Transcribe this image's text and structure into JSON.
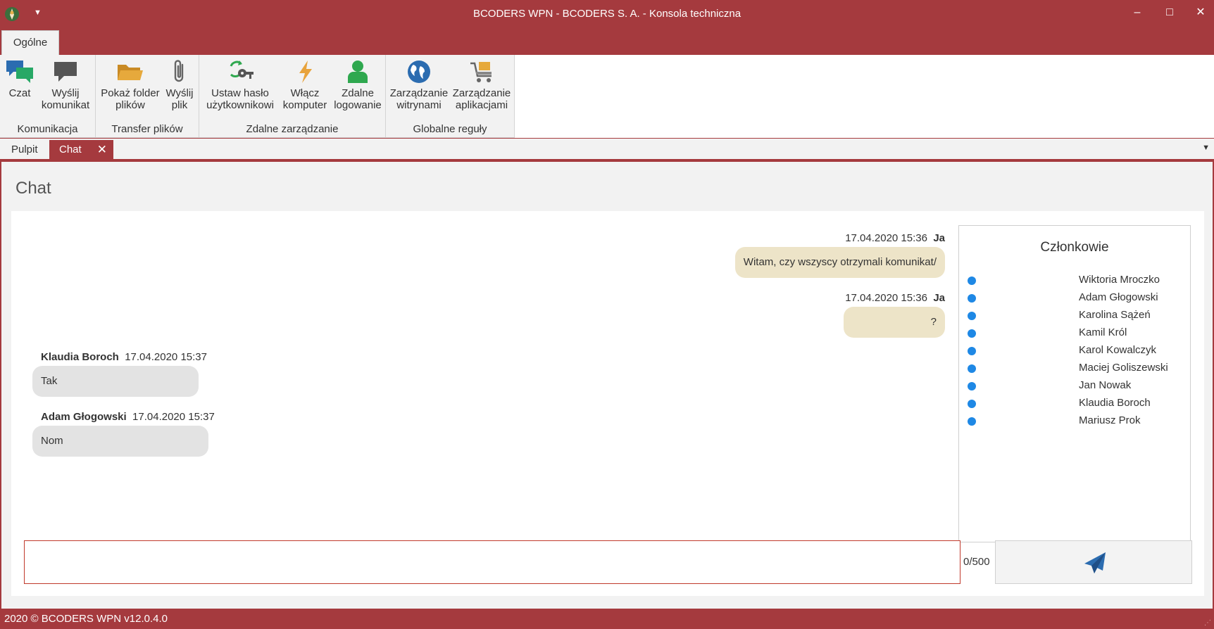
{
  "window": {
    "title": "BCODERS WPN - BCODERS S. A. - Konsola techniczna",
    "controls": {
      "minimize": "–",
      "maximize": "□",
      "close": "✕"
    }
  },
  "ribbon": {
    "tab": "Ogólne",
    "groups": [
      {
        "label": "Komunikacja",
        "buttons": [
          {
            "label": "Czat",
            "icon": "chat-bubbles-icon"
          },
          {
            "label": "Wyślij\nkomunikat",
            "icon": "message-icon"
          }
        ]
      },
      {
        "label": "Transfer plików",
        "buttons": [
          {
            "label": "Pokaż folder\nplików",
            "icon": "folder-icon"
          },
          {
            "label": "Wyślij\nplik",
            "icon": "paperclip-icon"
          }
        ]
      },
      {
        "label": "Zdalne zarządzanie",
        "buttons": [
          {
            "label": "Ustaw hasło\nużytkownikowi",
            "icon": "key-refresh-icon"
          },
          {
            "label": "Włącz\nkomputer",
            "icon": "lightning-icon"
          },
          {
            "label": "Zdalne\nlogowanie",
            "icon": "user-icon"
          }
        ]
      },
      {
        "label": "Globalne reguły",
        "buttons": [
          {
            "label": "Zarządzanie\nwitrynami",
            "icon": "globe-icon"
          },
          {
            "label": "Zarządzanie\naplikacjami",
            "icon": "cart-icon"
          }
        ]
      }
    ]
  },
  "doc_tabs": {
    "pulpit": "Pulpit",
    "chat": "Chat",
    "close": "✕"
  },
  "page": {
    "title": "Chat"
  },
  "messages": [
    {
      "side": "out",
      "time": "17.04.2020 15:36",
      "author": "Ja",
      "text": "Witam, czy wszyscy otrzymali komunikat/"
    },
    {
      "side": "out",
      "time": "17.04.2020 15:36",
      "author": "Ja",
      "text": "?"
    },
    {
      "side": "in",
      "time": "17.04.2020 15:37",
      "author": "Klaudia Boroch",
      "text": "Tak"
    },
    {
      "side": "in",
      "time": "17.04.2020 15:37",
      "author": "Adam Głogowski",
      "text": "Nom"
    }
  ],
  "members": {
    "title": "Członkowie",
    "status_color": "#1e88e5",
    "list": [
      "Wiktoria Mroczko",
      "Adam Głogowski",
      "Karolina Sążeń",
      "Kamil Król",
      "Karol Kowalczyk",
      "Maciej Goliszewski",
      "Jan Nowak",
      "Klaudia Boroch",
      "Mariusz Prok"
    ]
  },
  "composer": {
    "value": "",
    "counter": "0/500",
    "send_icon": "send-paper-plane-icon"
  },
  "status": {
    "text": "2020 ©  BCODERS WPN v12.0.4.0"
  },
  "colors": {
    "brand": "#a53a3e",
    "bubble_out": "#ede4c8",
    "bubble_in": "#e3e3e3",
    "send_icon": "#2b6cb0"
  }
}
